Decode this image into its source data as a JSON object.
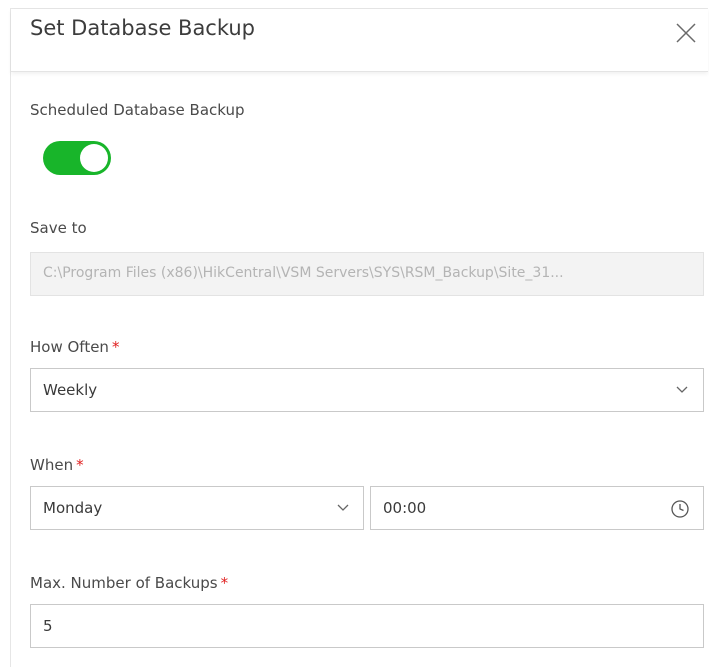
{
  "dialog": {
    "title": "Set Database Backup"
  },
  "scheduled_backup": {
    "label": "Scheduled Database Backup",
    "enabled": true,
    "toggle_color": "#18b52a"
  },
  "save_to": {
    "label": "Save to",
    "value": "C:\\Program Files (x86)\\HikCentral\\VSM Servers\\SYS\\RSM_Backup\\Site_31..."
  },
  "how_often": {
    "label": "How Often",
    "required_mark": "*",
    "value": "Weekly"
  },
  "when": {
    "label": "When",
    "required_mark": "*",
    "day_value": "Monday",
    "time_value": "00:00"
  },
  "max_backups": {
    "label": "Max. Number of Backups",
    "required_mark": "*",
    "value": "5"
  },
  "colors": {
    "required": "#e02020",
    "toggle_on": "#18b52a"
  }
}
